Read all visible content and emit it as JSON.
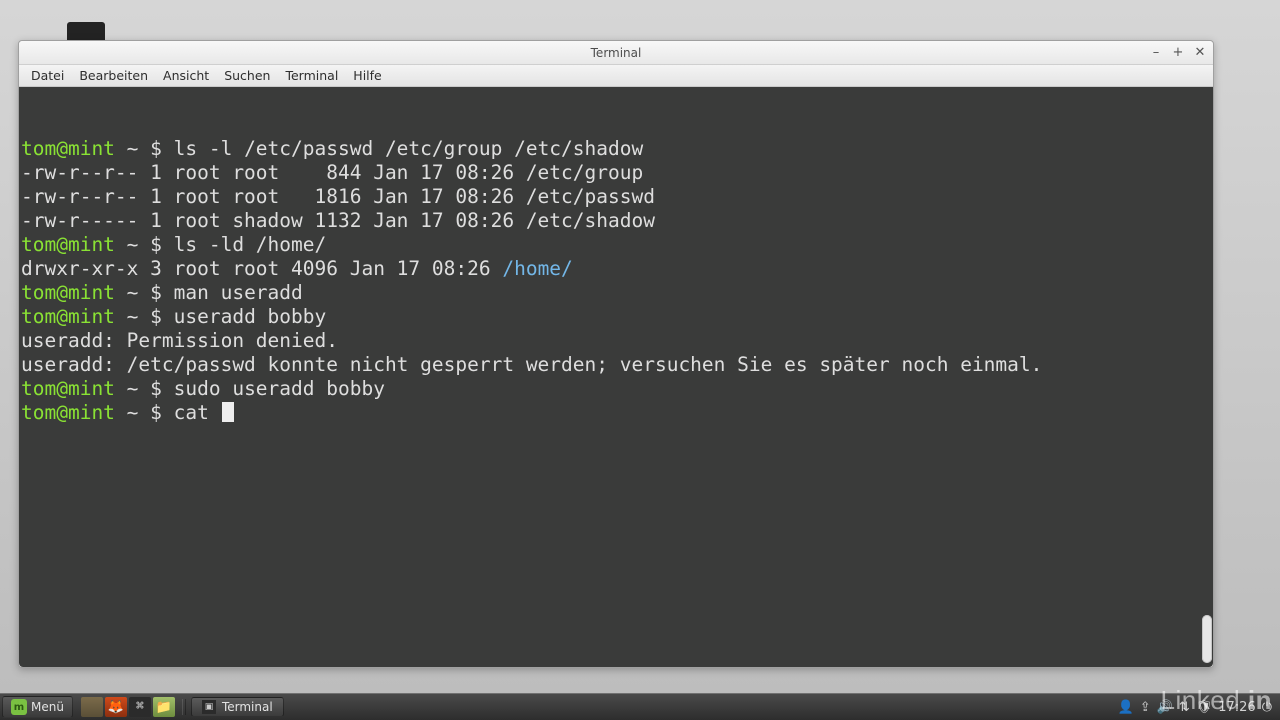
{
  "window": {
    "title": "Terminal",
    "controls": {
      "min": "–",
      "max": "+",
      "close": "✕"
    }
  },
  "menubar": {
    "items": [
      "Datei",
      "Bearbeiten",
      "Ansicht",
      "Suchen",
      "Terminal",
      "Hilfe"
    ]
  },
  "prompt": {
    "userhost": "tom@mint",
    "sep": " ~ $ "
  },
  "term": {
    "lines": [
      {
        "type": "cmd",
        "cmd": "ls -l /etc/passwd /etc/group /etc/shadow"
      },
      {
        "type": "out",
        "text": "-rw-r--r-- 1 root root    844 Jan 17 08:26 /etc/group"
      },
      {
        "type": "out",
        "text": "-rw-r--r-- 1 root root   1816 Jan 17 08:26 /etc/passwd"
      },
      {
        "type": "out",
        "text": "-rw-r----- 1 root shadow 1132 Jan 17 08:26 /etc/shadow"
      },
      {
        "type": "cmd",
        "cmd": "ls -ld /home/"
      },
      {
        "type": "out_colorpath",
        "prefix": "drwxr-xr-x 3 root root 4096 Jan 17 08:26 ",
        "path": "/home/"
      },
      {
        "type": "cmd",
        "cmd": "man useradd"
      },
      {
        "type": "cmd",
        "cmd": "useradd bobby"
      },
      {
        "type": "out",
        "text": "useradd: Permission denied."
      },
      {
        "type": "out",
        "text": "useradd: /etc/passwd konnte nicht gesperrt werden; versuchen Sie es später noch einmal."
      },
      {
        "type": "cmd",
        "cmd": "sudo useradd bobby"
      },
      {
        "type": "cmd_cursor",
        "cmd": "cat "
      }
    ]
  },
  "taskbar": {
    "menu_label": "Menü",
    "active_task": "Terminal",
    "clock": "17:26"
  },
  "watermark": {
    "a": "Linked",
    "b": "in"
  }
}
